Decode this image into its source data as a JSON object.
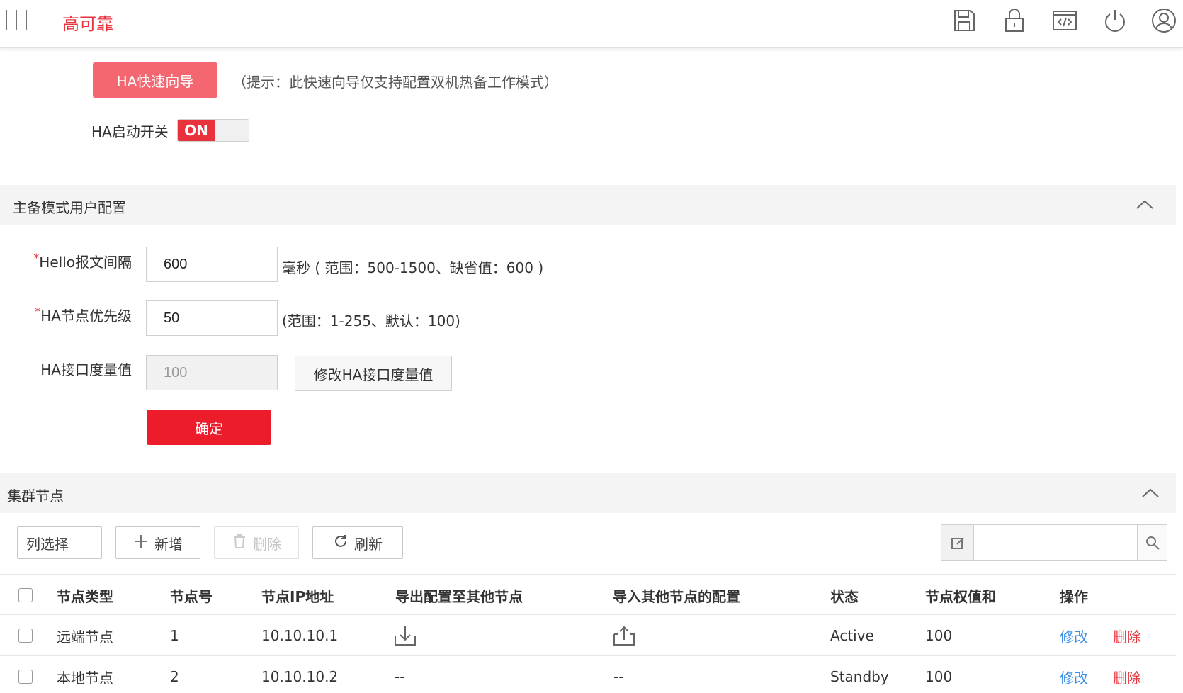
{
  "app": {
    "title": "高可靠"
  },
  "topbar_icons": [
    "save-icon",
    "lock-icon",
    "code-window-icon",
    "power-icon",
    "user-icon"
  ],
  "wizard": {
    "button_label": "HA快速向导",
    "tip": "（提示：此快速向导仅支持配置双机热备工作模式）"
  },
  "ha_switch": {
    "label": "HA启动开关",
    "state_label": "ON"
  },
  "section_master": {
    "title": "主备模式用户配置"
  },
  "form": {
    "hello_interval": {
      "label": "Hello报文间隔",
      "value": "600",
      "hint": "毫秒 ( 范围：500-1500、缺省值：600 )"
    },
    "node_priority": {
      "label": "HA节点优先级",
      "value": "50",
      "hint": "(范围：1-255、默认：100)"
    },
    "interface_metric": {
      "label": "HA接口度量值",
      "value": "100",
      "modify_label": "修改HA接口度量值"
    },
    "confirm_label": "确定"
  },
  "section_cluster": {
    "title": "集群节点"
  },
  "toolbar": {
    "column_select": "列选择",
    "add": "新增",
    "delete": "删除",
    "refresh": "刷新",
    "search_value": ""
  },
  "table": {
    "columns": [
      "节点类型",
      "节点号",
      "节点IP地址",
      "导出配置至其他节点",
      "导入其他节点的配置",
      "状态",
      "节点权值和",
      "操作"
    ],
    "rows": [
      {
        "type": "远端节点",
        "number": "1",
        "ip": "10.10.10.1",
        "export": "download-icon",
        "import": "upload-icon",
        "status": "Active",
        "weight": "100",
        "edit": "修改",
        "delete": "删除"
      },
      {
        "type": "本地节点",
        "number": "2",
        "ip": "10.10.10.2",
        "export": "--",
        "import": "--",
        "status": "Standby",
        "weight": "100",
        "edit": "修改",
        "delete": "删除"
      }
    ]
  },
  "colors": {
    "accent": "#e8333c",
    "wizard": "#f46770",
    "link": "#3a8ee6"
  }
}
